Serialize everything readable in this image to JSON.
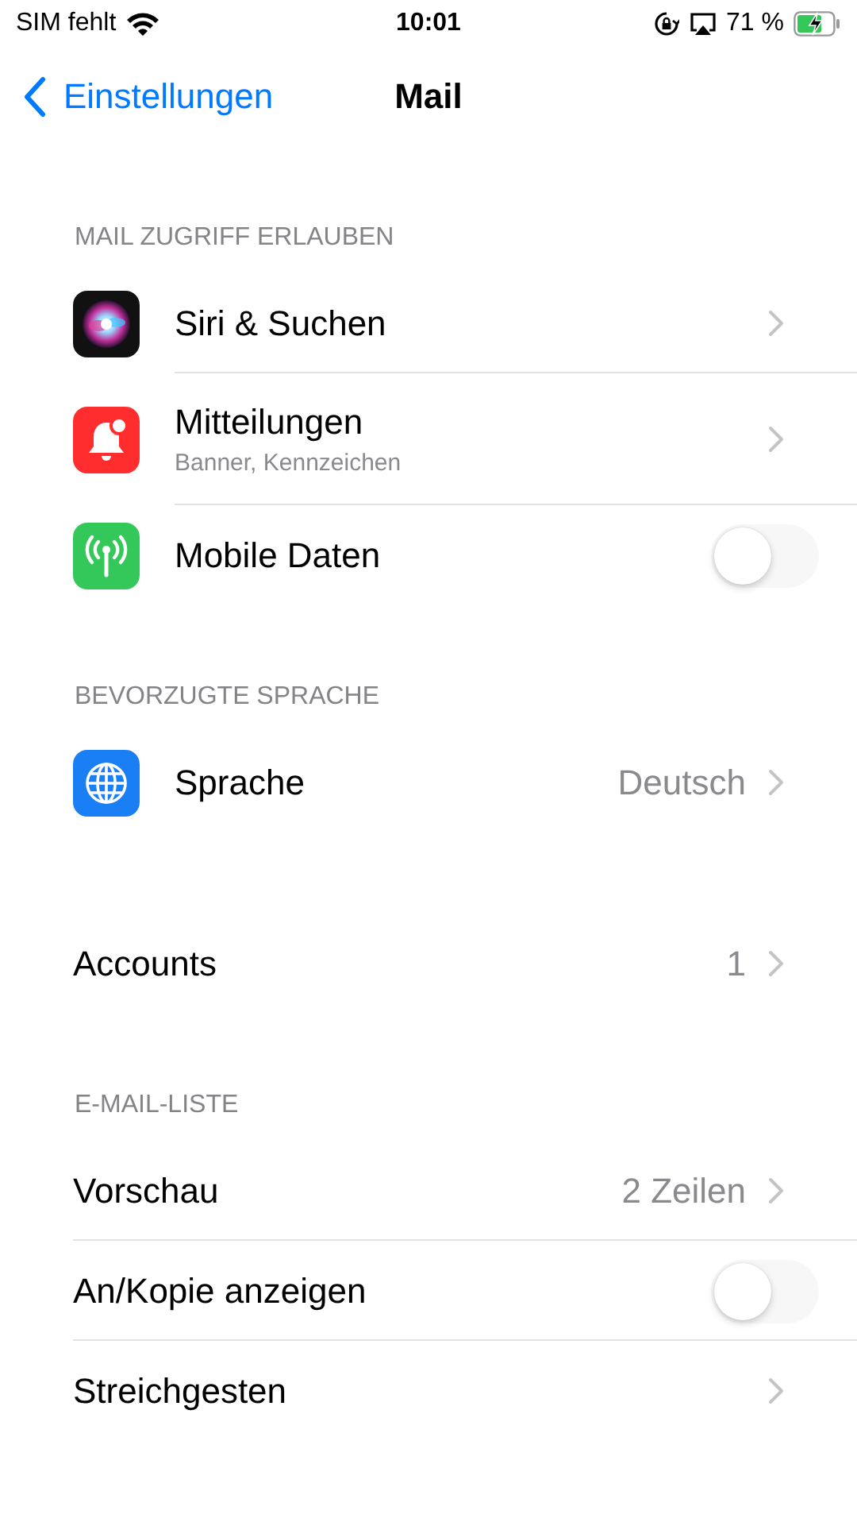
{
  "status_bar": {
    "carrier": "SIM fehlt",
    "time": "10:01",
    "battery_percent": "71 %"
  },
  "nav_bar": {
    "back_label": "Einstellungen",
    "title": "Mail"
  },
  "sections": [
    {
      "header": "MAIL ZUGRIFF ERLAUBEN",
      "rows": [
        {
          "icon": {
            "kind": "siri"
          },
          "label": "Siri & Suchen",
          "kind": "link"
        },
        {
          "icon": {
            "kind": "bell"
          },
          "label": "Mitteilungen",
          "subtitle": "Banner, Kennzeichen",
          "kind": "link"
        },
        {
          "icon": {
            "kind": "antenna"
          },
          "label": "Mobile Daten",
          "kind": "toggle",
          "on": false
        }
      ]
    },
    {
      "header": "BEVORZUGTE SPRACHE",
      "rows": [
        {
          "icon": {
            "kind": "globe"
          },
          "label": "Sprache",
          "value": "Deutsch",
          "kind": "link"
        }
      ]
    },
    {
      "rows": [
        {
          "label": "Accounts",
          "value": "1",
          "kind": "link"
        }
      ]
    },
    {
      "header": "E-MAIL-LISTE",
      "rows": [
        {
          "label": "Vorschau",
          "value": "2 Zeilen",
          "kind": "link"
        },
        {
          "label": "An/Kopie anzeigen",
          "kind": "toggle",
          "on": false
        },
        {
          "label": "Streichgesten",
          "kind": "link"
        }
      ]
    }
  ]
}
